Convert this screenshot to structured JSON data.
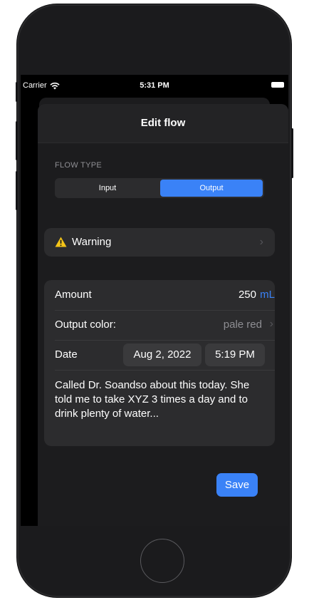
{
  "status_bar": {
    "carrier": "Carrier",
    "time": "5:31 PM"
  },
  "nav": {
    "title": "Edit flow"
  },
  "flow_type": {
    "section_label": "FLOW TYPE",
    "options": [
      "Input",
      "Output"
    ],
    "selected": "Output"
  },
  "warning": {
    "label": "Warning"
  },
  "details": {
    "amount_label": "Amount",
    "amount_value": "250",
    "amount_unit": "mL",
    "output_color_label": "Output color:",
    "output_color_value": "pale red",
    "date_label": "Date",
    "date_value": "Aug 2, 2022",
    "time_value": "5:19 PM",
    "notes": "Called Dr. Soandso about this today. She told me to take XYZ 3 times a day and to drink plenty of water..."
  },
  "actions": {
    "save_label": "Save"
  },
  "colors": {
    "accent": "#3a82f7",
    "warning": "#f5c518",
    "background": "#1c1c1e",
    "card": "#2c2c2e"
  },
  "icons": {
    "wifi": "wifi-icon",
    "battery": "battery-icon",
    "warning": "warning-triangle-icon",
    "chevron": "chevron-right-icon"
  }
}
